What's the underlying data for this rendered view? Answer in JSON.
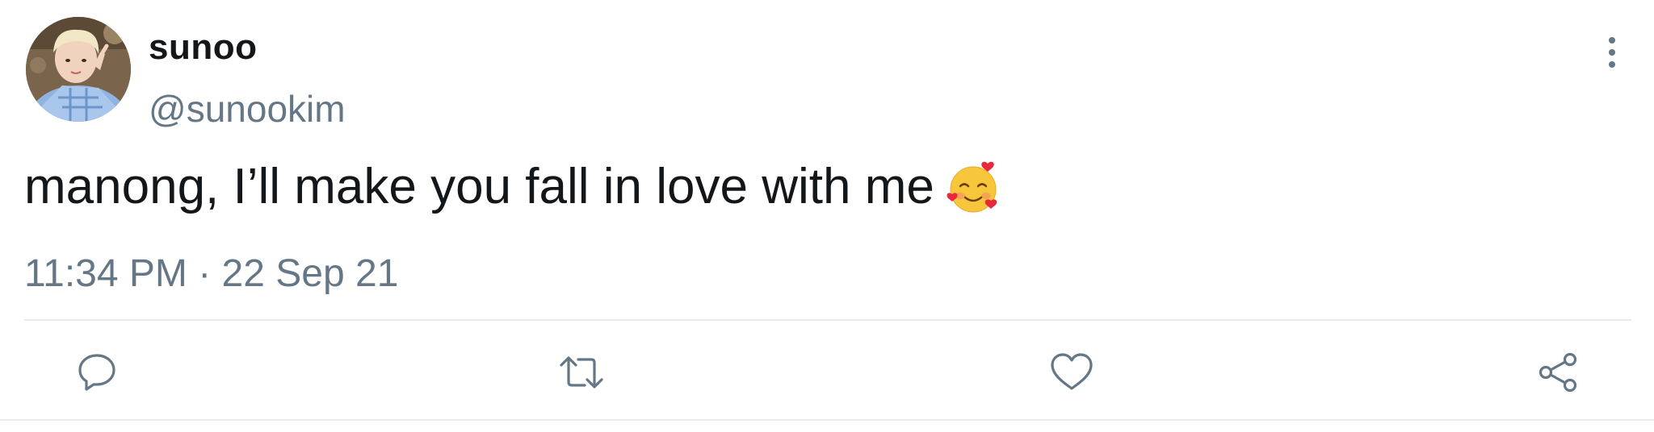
{
  "user": {
    "display_name": "sunoo",
    "handle": "@sunookim",
    "avatar_icon": "profile-photo"
  },
  "tweet": {
    "text": "manong, I’ll make you fall in love with me",
    "emoji": "smiling-face-with-hearts-emoji",
    "timestamp": "11:34 PM · 22 Sep 21"
  },
  "actions": [
    {
      "name": "reply",
      "icon": "reply-icon"
    },
    {
      "name": "retweet",
      "icon": "retweet-icon"
    },
    {
      "name": "like",
      "icon": "heart-icon"
    },
    {
      "name": "share",
      "icon": "share-icon"
    }
  ],
  "colors": {
    "text": "#14171a",
    "secondary": "#657786",
    "divider": "#e6ecf0"
  }
}
